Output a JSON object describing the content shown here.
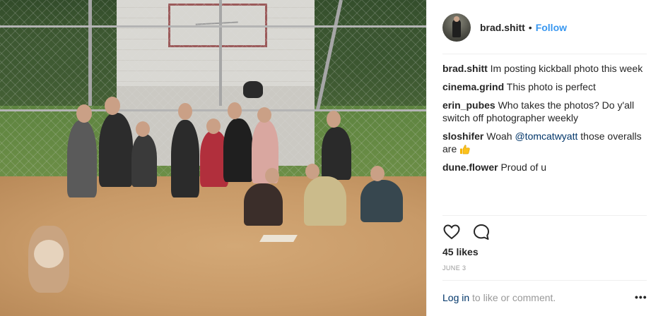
{
  "post": {
    "photo_alt": "kickball team photo",
    "author": {
      "username": "brad.shitt",
      "follow_label": "Follow",
      "separator": "•"
    },
    "comments": [
      {
        "user": "brad.shitt",
        "text": "Im posting kickball photo this week"
      },
      {
        "user": "cinema.grind",
        "text": "This photo is perfect"
      },
      {
        "user": "erin_pubes",
        "text": "Who takes the photos? Do y'all switch off photographer weekly"
      },
      {
        "user": "sloshifer",
        "text_before": "Woah ",
        "mention": "@tomcatwyatt",
        "text_after": " those overalls are",
        "emoji": "thumbs-up-emoji"
      },
      {
        "user": "dune.flower",
        "text": "Proud of u"
      }
    ],
    "actions": {
      "like_icon": "heart-icon",
      "comment_icon": "speech-bubble-icon"
    },
    "likes_label": "45 likes",
    "date": "JUNE 3",
    "footer": {
      "login_label": "Log in",
      "rest": " to like or comment.",
      "more_label": "•••"
    }
  },
  "colors": {
    "link": "#3897f0",
    "dark_link": "#003569",
    "muted": "#999999",
    "text": "#262626"
  }
}
